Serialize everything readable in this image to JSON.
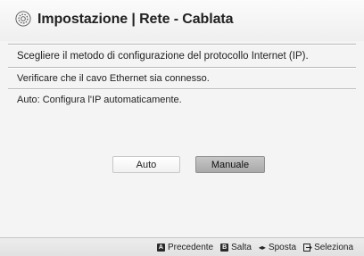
{
  "header": {
    "title": "Impostazione | Rete - Cablata",
    "icon": "settings-gear-icon"
  },
  "content": {
    "instruction": "Scegliere il metodo di configurazione del protocollo Internet (IP).",
    "cable_check": "Verificare che il cavo Ethernet sia connesso.",
    "option_description": "Auto: Configura l'IP automaticamente."
  },
  "buttons": {
    "auto_label": "Auto",
    "manual_label": "Manuale",
    "selected": "Manuale"
  },
  "footer": {
    "back_key": "A",
    "back_label": "Precedente",
    "skip_key": "B",
    "skip_label": "Salta",
    "move_glyph": "◂▸",
    "move_label": "Sposta",
    "select_label": "Seleziona"
  }
}
